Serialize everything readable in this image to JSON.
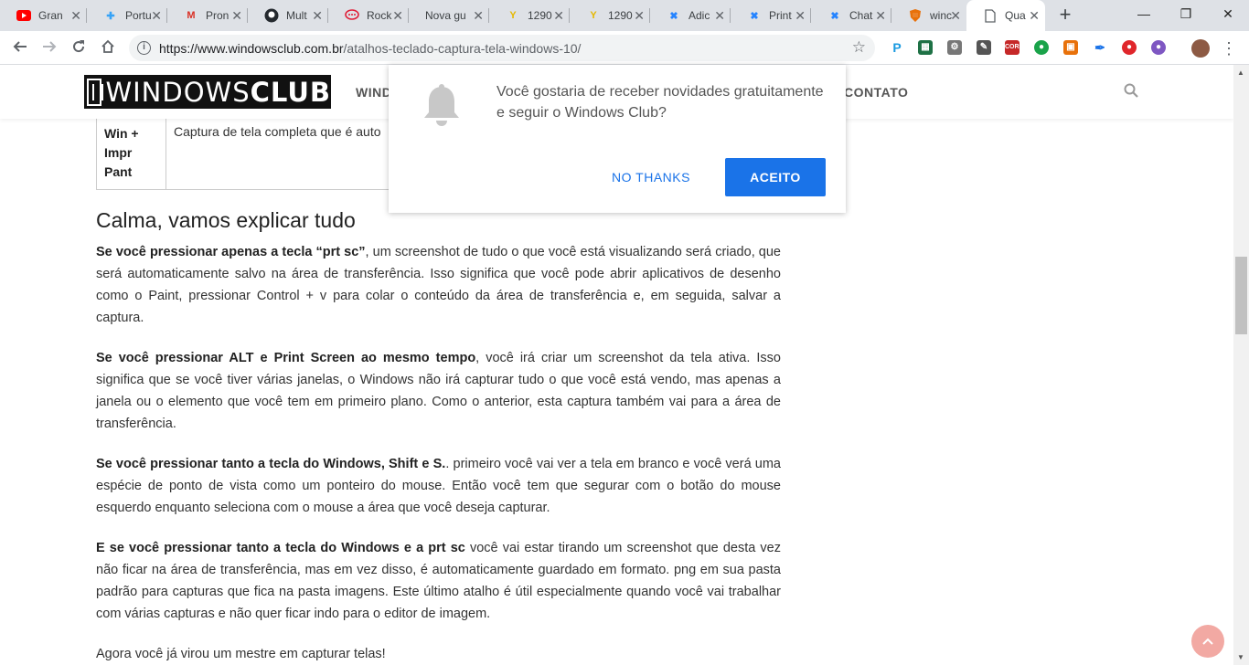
{
  "browser": {
    "tabs": [
      {
        "title": "Gran",
        "icon": "youtube-icon",
        "color": "#ff0000"
      },
      {
        "title": "Portu",
        "icon": "portuguese-app-icon",
        "color": "#36a3f7"
      },
      {
        "title": "Pron",
        "icon": "gmail-icon",
        "color": "#d93025"
      },
      {
        "title": "Mult",
        "icon": "github-icon",
        "color": "#24292e"
      },
      {
        "title": "Rock",
        "icon": "rocketchat-icon",
        "color": "#e01e37"
      },
      {
        "title": "Nova gu",
        "icon": "",
        "color": ""
      },
      {
        "title": "1290",
        "icon": "yellow-bird-icon",
        "color": "#e6b800"
      },
      {
        "title": "1290",
        "icon": "yellow-bird-icon",
        "color": "#e6b800"
      },
      {
        "title": "Adic",
        "icon": "confluence-icon",
        "color": "#2684ff"
      },
      {
        "title": "Print",
        "icon": "confluence-icon",
        "color": "#2684ff"
      },
      {
        "title": "Chat",
        "icon": "confluence-icon",
        "color": "#2684ff"
      },
      {
        "title": "winc",
        "icon": "shield-icon",
        "color": "#e8710a"
      },
      {
        "title": "Qua",
        "icon": "document-icon",
        "color": "#5f6368",
        "active": true
      }
    ],
    "url_host": "https://www.windowsclub.com.br",
    "url_path": "/atalhos-teclado-captura-tela-windows-10/"
  },
  "site": {
    "logo_text_light": "WINDOWS",
    "logo_text_bold": "CLUB",
    "nav_left": "WINDO",
    "nav_right": "CONTATO"
  },
  "table": {
    "shortcut": "Win + Impr Pant",
    "description": "Captura de tela completa que é auto"
  },
  "article": {
    "heading": "Calma, vamos explicar tudo",
    "p1_bold": "Se você pressionar apenas a tecla “prt sc”",
    "p1_text": ", um screenshot de tudo o que você está visualizando será criado, que será automaticamente salvo na área de transferência. Isso significa que você pode abrir aplicativos de desenho como o Paint, pressionar Control + v para colar o conteúdo da área de transferência e, em seguida, salvar a captura.",
    "p2_bold": "Se você pressionar ALT e Print Screen ao mesmo tempo",
    "p2_text": ", você irá criar um screenshot da tela ativa. Isso significa que se você tiver várias janelas, o Windows não irá capturar tudo o que você está vendo, mas apenas a janela ou o elemento que você tem em primeiro plano. Como o anterior, esta captura também vai para a área de transferência.",
    "p3_bold": "Se você pressionar tanto a tecla do Windows, Shift e S.",
    "p3_text": ". primeiro você vai ver a tela em branco e você verá uma espécie de ponto de vista como um ponteiro do mouse. Então você tem que segurar com o botão do mouse esquerdo enquanto seleciona com o mouse a área que você deseja capturar.",
    "p4_bold": "E se você pressionar tanto a tecla do Windows e a prt sc",
    "p4_text": " você vai estar tirando um screenshot que desta vez não ficar na área de transferência, mas em vez disso, é automaticamente guardado em formato. png em sua pasta padrão para capturas que fica na pasta imagens. Este último atalho é útil especialmente quando você vai trabalhar com várias capturas e não quer ficar indo para o editor de imagem.",
    "p5_text": "Agora você já virou um mestre em capturar telas!"
  },
  "dialog": {
    "message": "Você gostaria de receber novidades gratuitamente e seguir o Windows Club?",
    "decline_label": "NO THANKS",
    "accept_label": "ACEITO"
  },
  "colors": {
    "accent": "#1a73e8",
    "scroll_top_button": "#f2a9a3"
  }
}
